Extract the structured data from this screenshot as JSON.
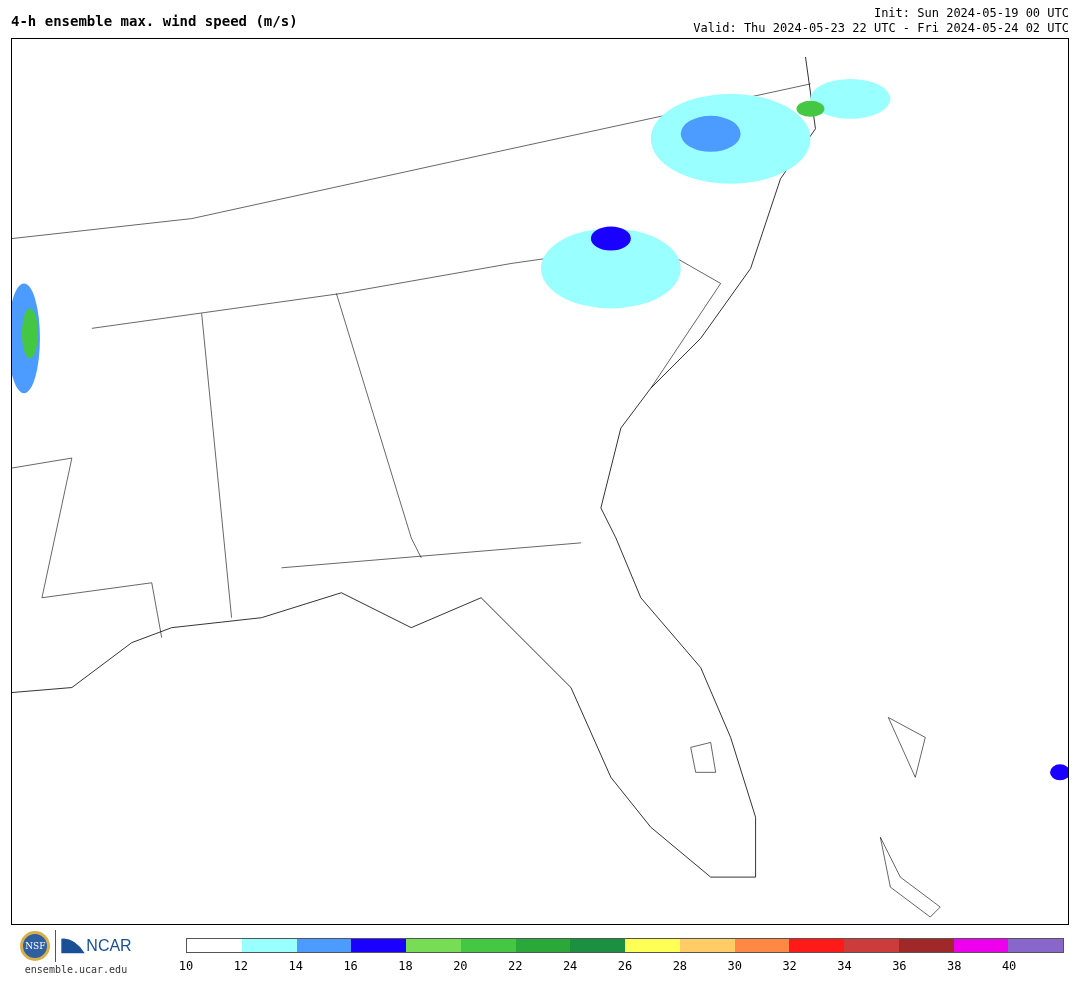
{
  "title": "4-h ensemble max. wind speed (m/s)",
  "init": "Init: Sun 2024-05-19 00 UTC",
  "valid": "Valid: Thu 2024-05-23 22 UTC - Fri 2024-05-24 02 UTC",
  "logos": {
    "nsf": "NSF",
    "ncar": "NCAR",
    "site": "ensemble.ucar.edu"
  },
  "legend": [
    {
      "color": "#ffffff",
      "label": "10"
    },
    {
      "color": "#99ffff",
      "label": "12"
    },
    {
      "color": "#4c9cff",
      "label": "14"
    },
    {
      "color": "#1a00ff",
      "label": "16"
    },
    {
      "color": "#77dd55",
      "label": "18"
    },
    {
      "color": "#44c844",
      "label": "20"
    },
    {
      "color": "#2aa83a",
      "label": "22"
    },
    {
      "color": "#1a9040",
      "label": "24"
    },
    {
      "color": "#ffff55",
      "label": "26"
    },
    {
      "color": "#ffcc66",
      "label": "28"
    },
    {
      "color": "#ff8844",
      "label": "30"
    },
    {
      "color": "#ff1a1a",
      "label": "32"
    },
    {
      "color": "#cc3c3c",
      "label": "34"
    },
    {
      "color": "#a02828",
      "label": "36"
    },
    {
      "color": "#ee00ee",
      "label": "38"
    },
    {
      "color": "#8866cc",
      "label": "40"
    }
  ]
}
